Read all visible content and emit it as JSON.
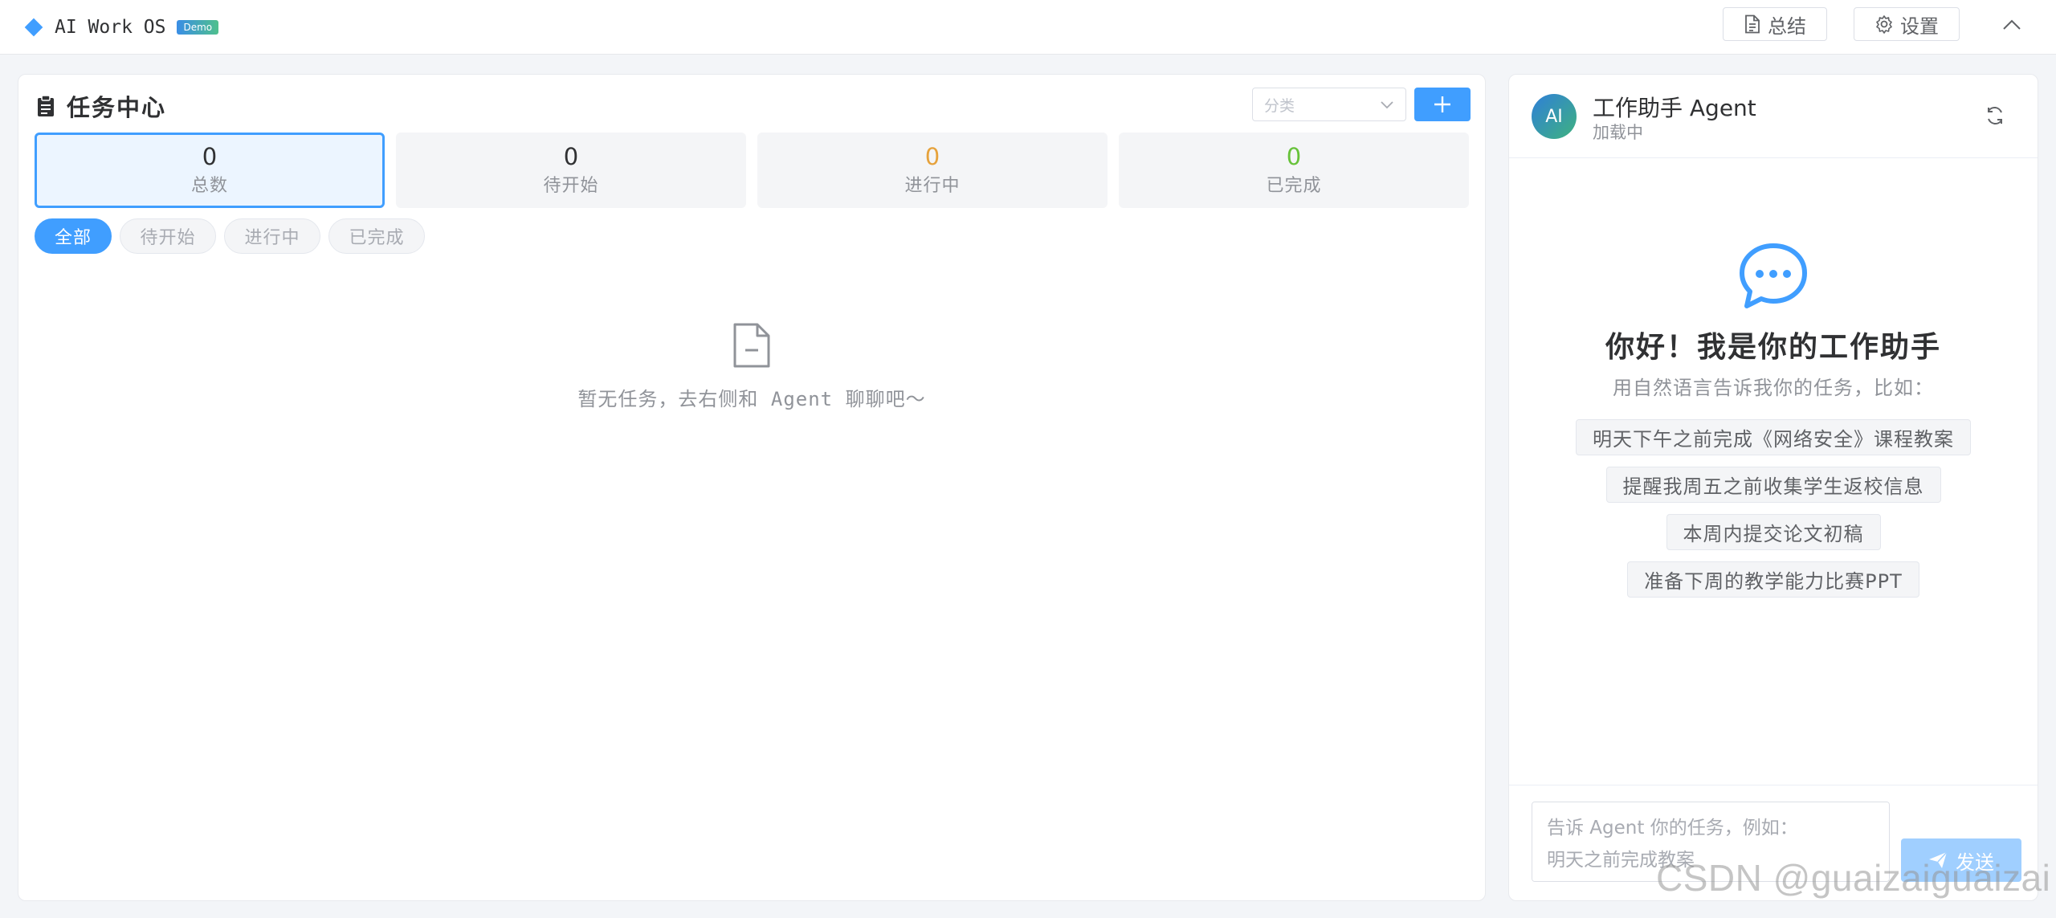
{
  "app": {
    "title": "AI Work OS",
    "badge": "Demo",
    "summary_label": "总结",
    "settings_label": "设置"
  },
  "tasks": {
    "title": "任务中心",
    "category_placeholder": "分类",
    "stats": [
      {
        "value": "0",
        "label": "总数",
        "color": "#303133"
      },
      {
        "value": "0",
        "label": "待开始",
        "color": "#303133"
      },
      {
        "value": "0",
        "label": "进行中",
        "color": "#e6a23c"
      },
      {
        "value": "0",
        "label": "已完成",
        "color": "#67c23a"
      }
    ],
    "filters": [
      "全部",
      "待开始",
      "进行中",
      "已完成"
    ],
    "empty_text": "暂无任务，去右侧和 Agent 聊聊吧～"
  },
  "agent": {
    "avatar_text": "AI",
    "name": "工作助手 Agent",
    "status": "加载中",
    "welcome_title": "你好！我是你的工作助手",
    "welcome_sub": "用自然语言告诉我你的任务，比如：",
    "suggestions": [
      "明天下午之前完成《网络安全》课程教案",
      "提醒我周五之前收集学生返校信息",
      "本周内提交论文初稿",
      "准备下周的教学能力比赛PPT"
    ],
    "input_placeholder": "告诉 Agent 你的任务，例如：\n明天之前完成教案",
    "send_label": "发送"
  },
  "watermark": "CSDN @guaizaiguaizai",
  "colors": {
    "accent": "#409eff",
    "in_progress": "#e6a23c",
    "done": "#67c23a"
  },
  "icons": {
    "brand": "diamond-icon",
    "summary": "document-icon",
    "settings": "gear-icon",
    "collapse": "chevron-up-icon",
    "tasks": "clipboard-icon",
    "add": "plus-icon",
    "empty": "document-minus-icon",
    "refresh": "refresh-icon",
    "chat": "chat-bubble-icon",
    "send": "paper-plane-icon"
  }
}
